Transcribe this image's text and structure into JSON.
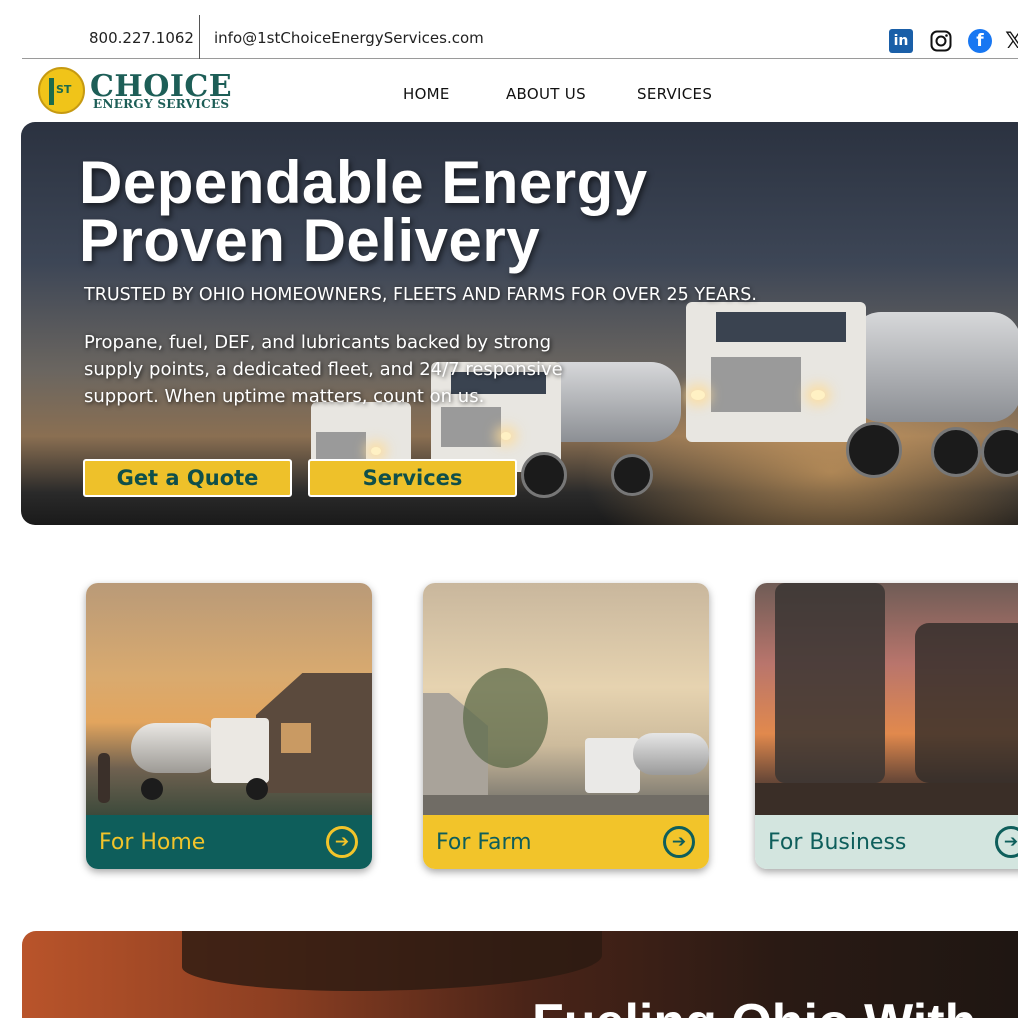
{
  "topbar": {
    "phone": "800.227.1062",
    "email": "info@1stChoiceEnergyServices.com",
    "social": [
      "linkedin-icon",
      "instagram-icon",
      "facebook-icon",
      "x-icon"
    ]
  },
  "logo": {
    "badge": "ST",
    "main": "CHOICE",
    "sub": "ENERGY SERVICES"
  },
  "nav": {
    "items": [
      "HOME",
      "ABOUT US",
      "SERVICES"
    ]
  },
  "hero": {
    "title_line1": "Dependable Energy",
    "title_line2": "Proven Delivery",
    "tagline": "TRUSTED BY OHIO HOMEOWNERS, FLEETS AND FARMS FOR OVER 25 YEARS.",
    "body": "Propane, fuel, DEF, and lubricants backed by strong supply points, a dedicated fleet, and 24/7 responsive support. When uptime matters, count on us.",
    "quote_label": "Get a Quote",
    "services_label": "Services"
  },
  "cards": [
    {
      "label": "For Home"
    },
    {
      "label": "For Farm"
    },
    {
      "label": "For Business"
    }
  ],
  "banner": {
    "title": "Fueling Ohio With"
  },
  "colors": {
    "brand_teal": "#0e5e5b",
    "brand_yellow": "#f2c42a",
    "card_business_bg": "#d3e5df"
  }
}
